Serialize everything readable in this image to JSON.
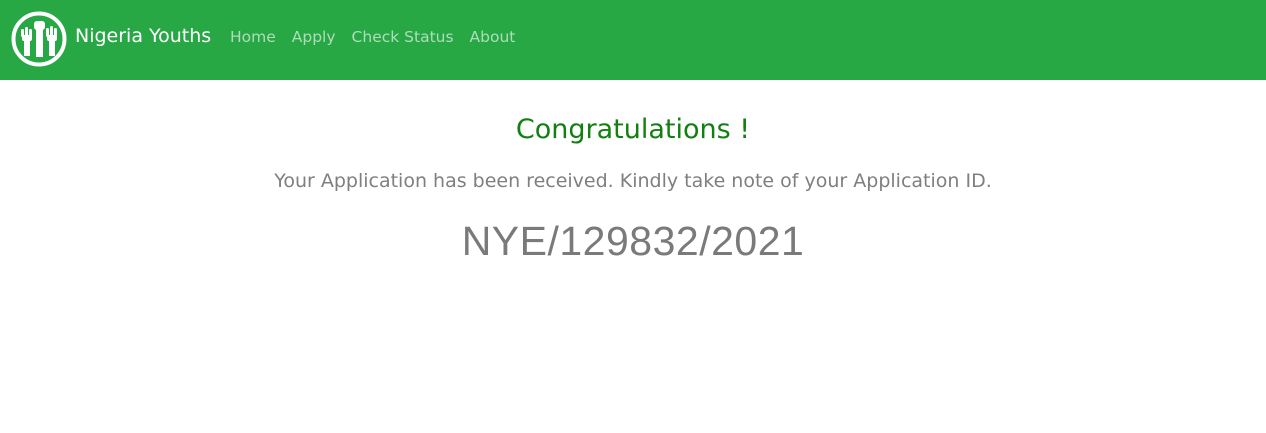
{
  "colors": {
    "navbar_bg": "#28a745",
    "title_green": "#118011",
    "text_gray": "#7f7f7f"
  },
  "navbar": {
    "brand": "Nigeria Youths",
    "logo_icon": "raised-fists-logo-icon",
    "links": [
      {
        "label": "Home"
      },
      {
        "label": "Apply"
      },
      {
        "label": "Check Status"
      },
      {
        "label": "About"
      }
    ]
  },
  "main": {
    "title": "Congratulations !",
    "message": "Your Application has been received. Kindly take note of your Application ID.",
    "application_id": "NYE/129832/2021"
  }
}
